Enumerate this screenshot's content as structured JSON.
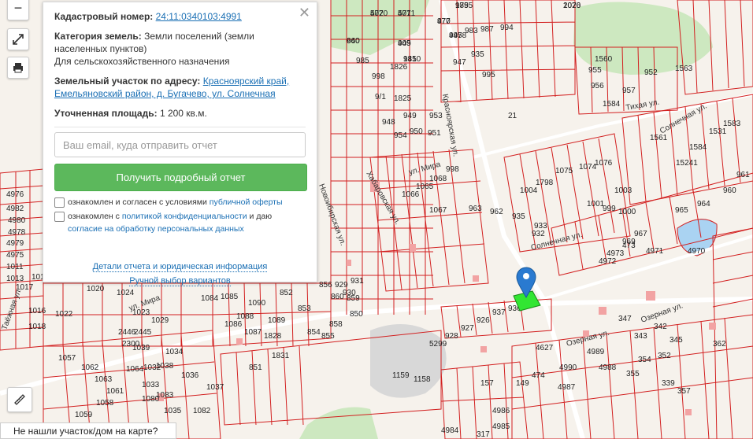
{
  "map": {
    "parcel_numbers": [
      "5070",
      "5071",
      "977",
      "979",
      "1070",
      "940",
      "945",
      "941",
      "945",
      "983",
      "987",
      "994",
      "985",
      "1826",
      "947",
      "935",
      "995",
      "998",
      "9/1",
      "1825",
      "948",
      "949",
      "950",
      "951",
      "953",
      "954",
      "955",
      "956",
      "957",
      "952",
      "1584",
      "1560",
      "1563",
      "21",
      "1561",
      "1584",
      "15241",
      "1531",
      "1583",
      "1076",
      "1074",
      "1075",
      "1798",
      "1004",
      "1003",
      "1001",
      "999",
      "1000",
      "998",
      "1068",
      "1065",
      "1066",
      "1067",
      "963",
      "962",
      "961",
      "960",
      "964",
      "965",
      "967",
      "969",
      "4973",
      "4972",
      "4971",
      "4970",
      "4976",
      "4982",
      "4980",
      "4978",
      "4979",
      "4975",
      "1011",
      "1013",
      "1015",
      "1017",
      "1016",
      "1018",
      "1022",
      "1020",
      "1024",
      "1023",
      "1029",
      "2445",
      "2446",
      "2300",
      "1039",
      "1057",
      "1062",
      "1063",
      "1061",
      "1058",
      "1059",
      "1064",
      "1032",
      "1033",
      "1034",
      "1038",
      "1036",
      "1037",
      "1035",
      "1082",
      "1080",
      "1083",
      "1084",
      "1085",
      "1090",
      "1088",
      "1089",
      "1086",
      "1087",
      "1828",
      "1831",
      "851",
      "852",
      "856",
      "853",
      "854",
      "855",
      "858",
      "850",
      "859",
      "860",
      "929",
      "930",
      "931",
      "932",
      "933",
      "935",
      "936",
      "937",
      "926",
      "927",
      "928",
      "5299",
      "1159",
      "1158",
      "4627",
      "4990",
      "4989",
      "4988",
      "4987",
      "4986",
      "4985",
      "4984",
      "317",
      "347",
      "343",
      "342",
      "345",
      "352",
      "354",
      "355",
      "357",
      "362",
      "339",
      "157",
      "149",
      "474",
      "473",
      "472",
      "471",
      "470",
      "1855",
      "2026",
      "660",
      "409",
      "1850",
      "4978"
    ],
    "streets": [
      "ул. Мира",
      "ул. Мира",
      "Таёжная ул.",
      "Красноярская ул.",
      "Хабаровская ул.",
      "Солнечная ул.",
      "Тихая ул.",
      "Солнечная ул.",
      "Озерная ул.",
      "Озерная ул.",
      "Новоибирская ул."
    ],
    "colors": {
      "parcel_line": "#d21f1f",
      "background": "#f4f1ec",
      "forest": "#cde8c0",
      "water": "#aad3f2",
      "selected": "#32e632"
    }
  },
  "controls": {
    "zoom_out_icon": "minus-icon",
    "fullscreen_icon": "expand-icon",
    "print_icon": "printer-icon",
    "ruler_icon": "ruler-icon"
  },
  "panel": {
    "cadastral_label": "Кадастровый номер:",
    "cadastral_value": "24:11:0340103:4991",
    "category_label": "Категория земель:",
    "category_value": "Земли поселений (земли населенных пунктов)",
    "category_usage": "Для сельскохозяйственного назначения",
    "address_label": "Земельный участок по адресу:",
    "address_value": "Красноярский край, Емельяновский район, д. Бугачево, ул. Солнечная",
    "area_label": "Уточненная площадь:",
    "area_value": "1 200 кв.м.",
    "email_placeholder": "Ваш email, куда отправить отчет",
    "submit_label": "Получить подробный отчет",
    "consent1_text": "ознакомлен и согласен с условиями",
    "consent1_link": "публичной оферты",
    "consent2_text": "ознакомлен с",
    "consent2_link": "политикой конфиденциальности",
    "consent2_mid": "и даю",
    "consent2_link2": "согласие на обработку персональных данных",
    "details_link": "Детали отчета и юридическая информация",
    "manual_link": "Ручной выбор вариантов",
    "close_icon": "close-icon"
  },
  "bottom": {
    "not_found_label": "Не нашли участок/дом на карте?"
  }
}
